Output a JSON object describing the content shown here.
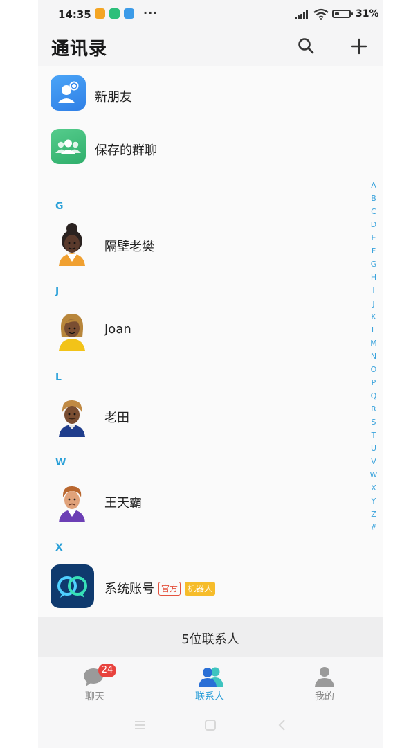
{
  "status_bar": {
    "time": "14:35",
    "battery": "31%",
    "battery_level": 0.31,
    "more": "···",
    "notif_colors": [
      "#f4a523",
      "#2cbf7a",
      "#3c9be8"
    ]
  },
  "header": {
    "title": "通讯录",
    "icons": [
      "search-icon",
      "plus-icon"
    ]
  },
  "shortcuts": [
    {
      "label": "新朋友",
      "icon": "new-friend-icon",
      "color": "#3d8ff0"
    },
    {
      "label": "保存的群聊",
      "icon": "group-chat-icon",
      "color": "#3dbf7c"
    }
  ],
  "sections": [
    {
      "letter": "G",
      "contacts": [
        {
          "name": "隔壁老樊"
        }
      ]
    },
    {
      "letter": "J",
      "contacts": [
        {
          "name": "Joan"
        }
      ]
    },
    {
      "letter": "L",
      "contacts": [
        {
          "name": "老田"
        }
      ]
    },
    {
      "letter": "W",
      "contacts": [
        {
          "name": "王天霸"
        }
      ]
    },
    {
      "letter": "X",
      "contacts": [
        {
          "name": "系统账号",
          "tags": [
            "官方",
            "机器人"
          ]
        }
      ]
    }
  ],
  "index_letters": [
    "A",
    "B",
    "C",
    "D",
    "E",
    "F",
    "G",
    "H",
    "I",
    "J",
    "K",
    "L",
    "M",
    "N",
    "O",
    "P",
    "Q",
    "R",
    "S",
    "T",
    "U",
    "V",
    "W",
    "X",
    "Y",
    "Z",
    "#"
  ],
  "contact_count": "5位联系人",
  "tabs": [
    {
      "label": "聊天",
      "badge": "24",
      "active": false,
      "icon": "chat-icon"
    },
    {
      "label": "联系人",
      "active": true,
      "icon": "contacts-icon"
    },
    {
      "label": "我的",
      "active": false,
      "icon": "profile-icon"
    }
  ],
  "colors": {
    "accent": "#2a9ed8",
    "badge": "#e8433e",
    "tag_official": "#e4533f",
    "tag_robot": "#f6bc2a",
    "inactive_tab": "#8a8a8a"
  }
}
